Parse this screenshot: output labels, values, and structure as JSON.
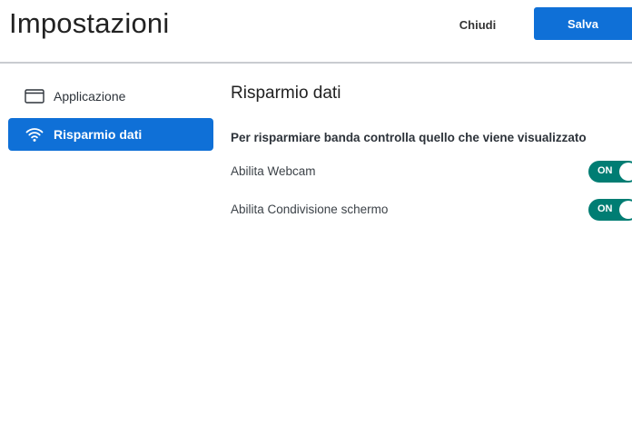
{
  "header": {
    "title": "Impostazioni",
    "close_label": "Chiudi",
    "save_label": "Salva"
  },
  "sidebar": {
    "items": [
      {
        "label": "Applicazione",
        "icon": "application-window-icon",
        "active": false
      },
      {
        "label": "Risparmio dati",
        "icon": "wifi-icon",
        "active": true
      }
    ]
  },
  "main": {
    "section_title": "Risparmio dati",
    "subtitle": "Per risparmiare banda controlla quello che viene visualizzato",
    "settings": [
      {
        "label": "Abilita Webcam",
        "toggle_text": "ON",
        "enabled": true
      },
      {
        "label": "Abilita Condivisione schermo",
        "toggle_text": "ON",
        "enabled": true
      }
    ]
  },
  "colors": {
    "accent": "#0f70d7",
    "toggle_on": "#007d73",
    "divider": "#c9ccd0"
  }
}
